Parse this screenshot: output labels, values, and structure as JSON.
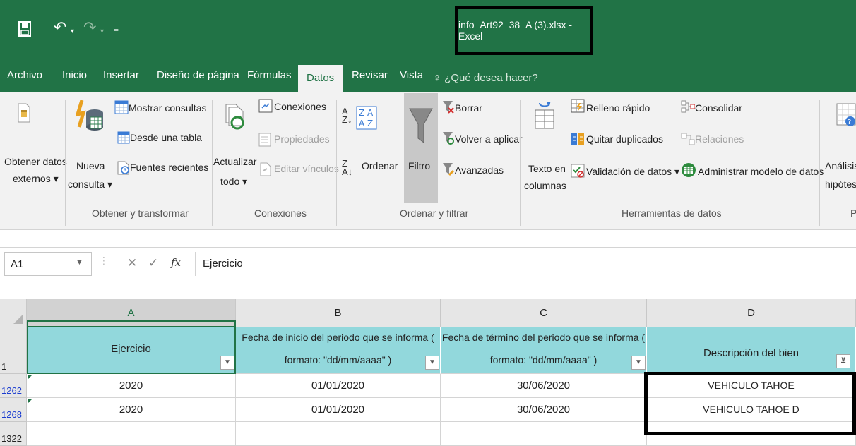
{
  "window": {
    "title": "info_Art92_38_A (3).xlsx - Excel"
  },
  "tabs": [
    {
      "label": "Archivo"
    },
    {
      "label": "Inicio"
    },
    {
      "label": "Insertar"
    },
    {
      "label": "Diseño de página"
    },
    {
      "label": "Fórmulas"
    },
    {
      "label": "Datos"
    },
    {
      "label": "Revisar"
    },
    {
      "label": "Vista"
    }
  ],
  "tell_me": "¿Qué desea hacer?",
  "ribbon": {
    "obtener_datos_externos": {
      "line1": "Obtener datos",
      "line2": "externos ▾"
    },
    "nueva_consulta": {
      "line1": "Nueva",
      "line2": "consulta ▾"
    },
    "mostrar_consultas": "Mostrar consultas",
    "desde_tabla": "Desde una tabla",
    "fuentes_recientes": "Fuentes recientes",
    "group_obtener": "Obtener y transformar",
    "actualizar": {
      "line1": "Actualizar",
      "line2": "todo ▾"
    },
    "conexiones": "Conexiones",
    "propiedades": "Propiedades",
    "editar_vinculos": "Editar vínculos",
    "group_conexiones": "Conexiones",
    "ordenar": "Ordenar",
    "filtro": "Filtro",
    "borrar": "Borrar",
    "volver_aplicar": "Volver a aplicar",
    "avanzadas": "Avanzadas",
    "group_ordenar": "Ordenar y filtrar",
    "texto_columnas": {
      "line1": "Texto en",
      "line2": "columnas"
    },
    "relleno_rapido": "Relleno rápido",
    "quitar_duplicados": "Quitar duplicados",
    "validacion": "Validación de datos  ▾",
    "consolidar": "Consolidar",
    "relaciones": "Relaciones",
    "administrar_modelo": "Administrar modelo de datos",
    "group_herramientas": "Herramientas de datos",
    "analisis": {
      "line1": "Análisis",
      "line2": "hipótes"
    },
    "group_partial": "P"
  },
  "formula_bar": {
    "name_box": "A1",
    "cancel_glyph": "✕",
    "enter_glyph": "✓",
    "fx_glyph": "fx",
    "value": "Ejercicio"
  },
  "sheet": {
    "columns": [
      "A",
      "B",
      "C",
      "D"
    ],
    "header_row_number": "1",
    "header_cells": [
      {
        "text": "Ejercicio"
      },
      {
        "line1": "Fecha de inicio del periodo que se informa (",
        "line2": "formato: \"dd/mm/aaaa\" )"
      },
      {
        "line1": "Fecha de término del periodo que se informa (",
        "line2": "formato: \"dd/mm/aaaa\" )"
      },
      {
        "text": "Descripción del bien"
      }
    ],
    "rows": [
      {
        "row": "1262",
        "cells": [
          "2020",
          "01/01/2020",
          "30/06/2020",
          "VEHICULO TAHOE"
        ]
      },
      {
        "row": "1268",
        "cells": [
          "2020",
          "01/01/2020",
          "30/06/2020",
          "VEHICULO TAHOE D"
        ]
      }
    ],
    "last_row": "1322"
  },
  "colors": {
    "excel_green": "#217346",
    "header_fill": "#92d8dc"
  }
}
